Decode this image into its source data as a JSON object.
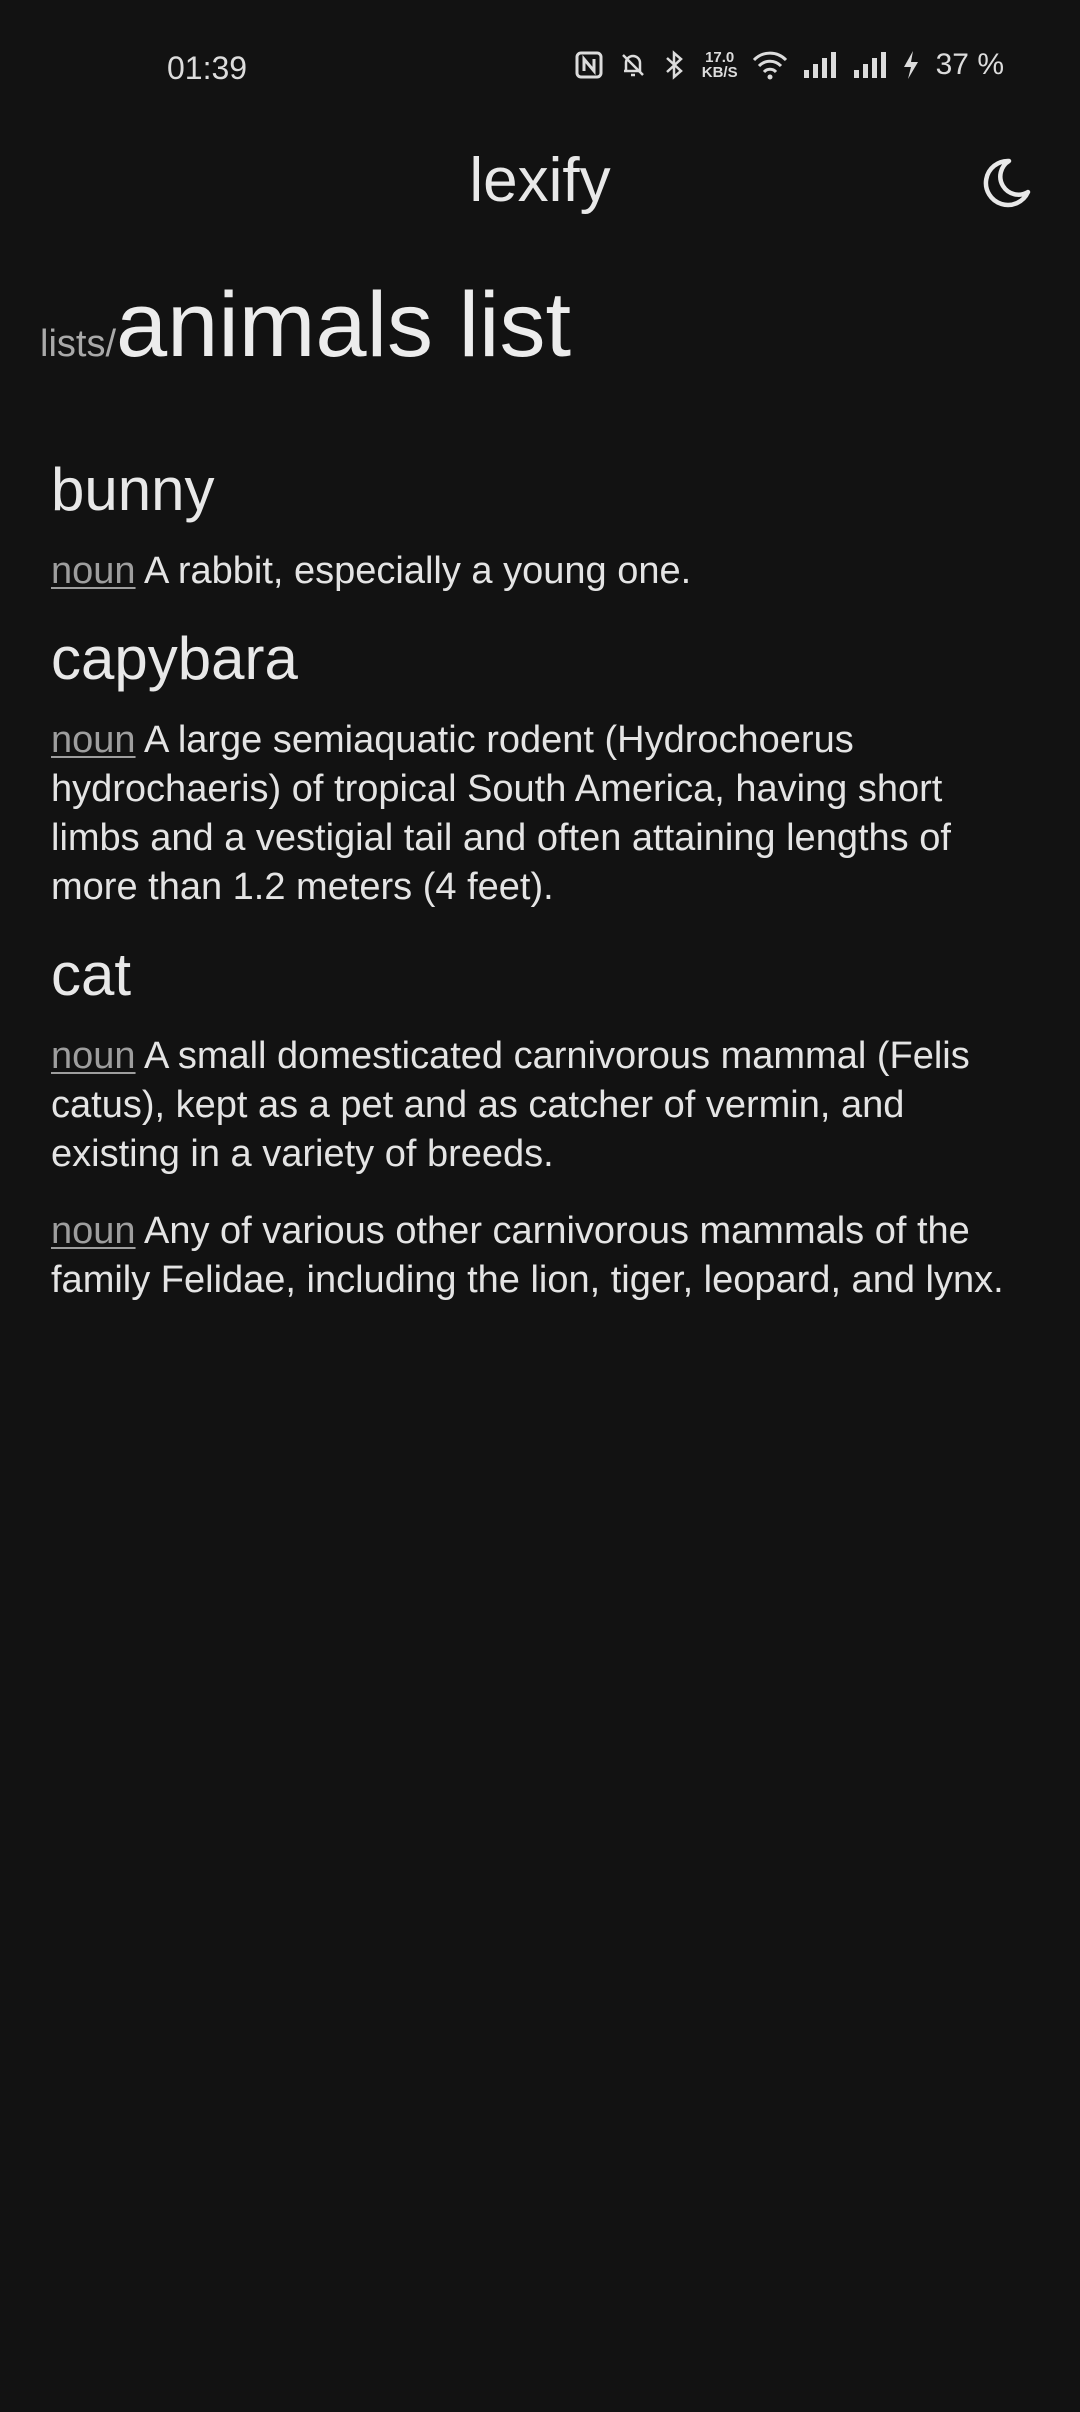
{
  "status_bar": {
    "time": "01:39",
    "speed_value": "17.0",
    "speed_unit": "KB/S",
    "battery": "37 %"
  },
  "app": {
    "title": "lexify",
    "theme_icon": "moon-icon"
  },
  "page": {
    "breadcrumb": "lists/",
    "title": "animals list"
  },
  "entries": [
    {
      "word": "bunny",
      "definitions": [
        {
          "pos": "noun",
          "text": "A rabbit, especially a young one."
        }
      ]
    },
    {
      "word": "capybara",
      "definitions": [
        {
          "pos": "noun",
          "text": "A large semiaquatic rodent (Hydrochoerus hydrochaeris) of tropical South America, having short limbs and a vestigial tail and often attaining lengths of more than 1.2 meters (4 feet)."
        }
      ]
    },
    {
      "word": "cat",
      "definitions": [
        {
          "pos": "noun",
          "text": "A small domesticated carnivorous mammal (Felis catus), kept as a pet and as catcher of vermin, and existing in a variety of breeds."
        },
        {
          "pos": "noun",
          "text": "Any of various other carnivorous mammals of the family Felidae, including the lion, tiger, leopard, and lynx."
        }
      ]
    }
  ]
}
